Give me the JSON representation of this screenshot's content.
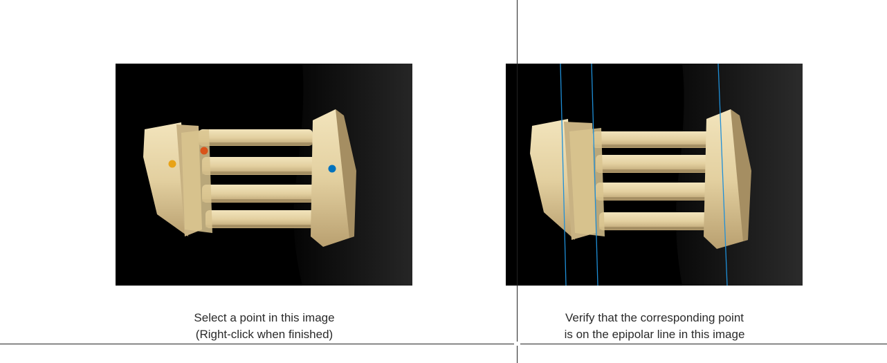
{
  "left_panel": {
    "caption_line1": "Select a point in this image",
    "caption_line2": "(Right-click when finished)",
    "selected_points": [
      {
        "name": "orange-point",
        "color": "#E8A317"
      },
      {
        "name": "red-point",
        "color": "#D95319"
      },
      {
        "name": "blue-point",
        "color": "#0072BD"
      }
    ]
  },
  "right_panel": {
    "caption_line1": "Verify that the corresponding point",
    "caption_line2": "is on the epipolar line in this image",
    "epipolar_line_color": "#1E8FD8",
    "epipolar_line_count": 3
  },
  "colors": {
    "background": "#ffffff",
    "image_background": "#000000",
    "temple_stone": "#E3D3A6",
    "cloth": "#1a1a1a"
  }
}
